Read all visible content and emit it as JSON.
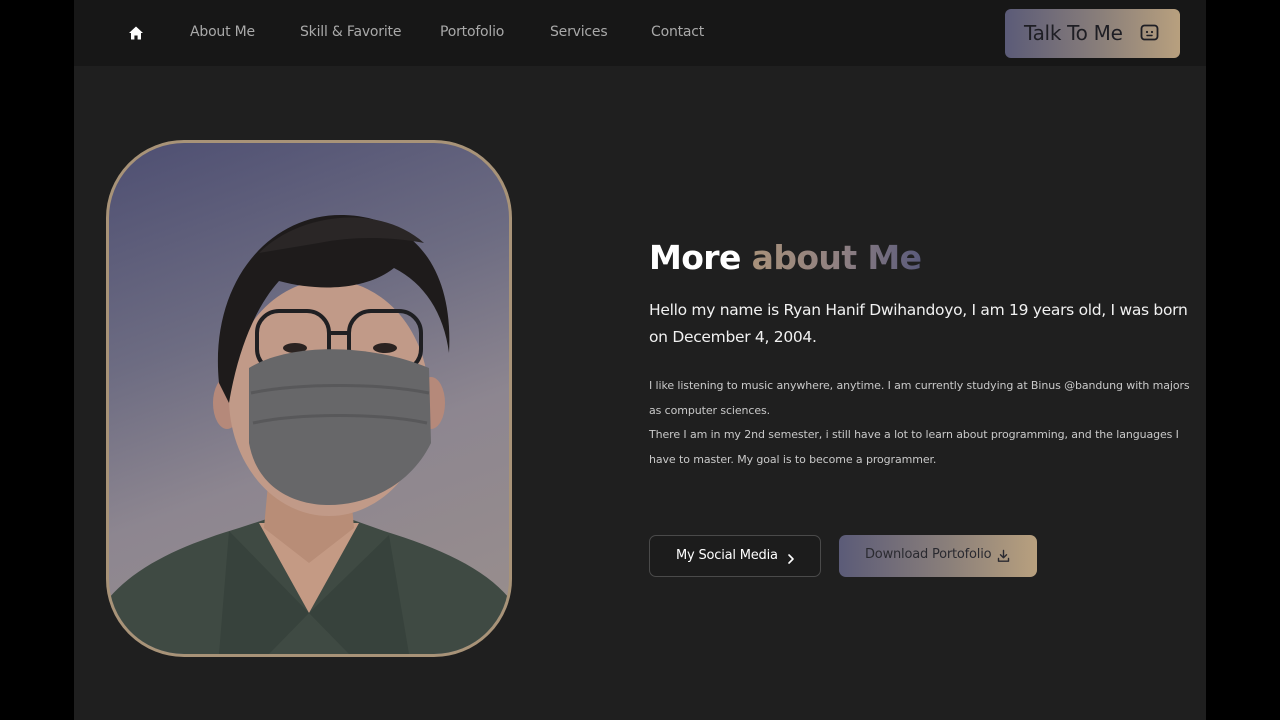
{
  "nav": {
    "home_icon": "home-icon",
    "links": [
      "About Me",
      "Skill & Favorite",
      "Portofolio",
      "Services",
      "Contact"
    ],
    "cta_label": "Talk To Me",
    "cta_icon": "chat-icon"
  },
  "hero": {
    "photo_alt": "Profile photo",
    "title_main": "More",
    "title_accent": "about Me",
    "lead": "Hello my name is Ryan Hanif Dwihandoyo, I am 19 years old, I was born on December 4, 2004.",
    "para1": "I like listening to music anywhere, anytime. I am currently studying at Binus @bandung with majors as computer sciences.",
    "para2": "There I am in my 2nd semester, i still have a lot to learn about programming, and the languages I have to master. My goal is to become a programmer.",
    "social_label": "My Social Media",
    "social_icon": "chevron-right-icon",
    "download_label": "Download Portofolio",
    "download_icon": "download-icon"
  },
  "colors": {
    "background": "#1f1f1f",
    "nav_background": "#171717",
    "accent_gradient_start": "#5b5b78",
    "accent_gradient_end": "#b8a07e",
    "frame_border": "#a89378"
  }
}
